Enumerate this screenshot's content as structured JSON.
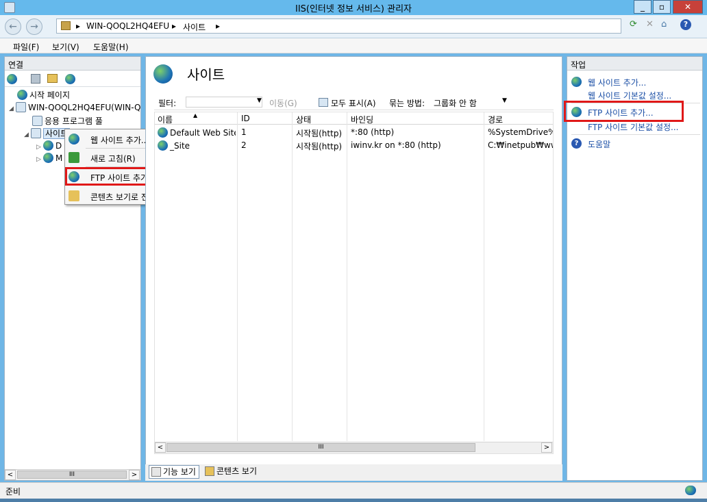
{
  "window": {
    "title": "IIS(인터넷 정보 서비스) 관리자",
    "min": "_",
    "max": "▫",
    "close": "✕"
  },
  "nav": {
    "back": "←",
    "forward": "→",
    "crumbs": [
      "▸",
      "WIN-QOQL2HQ4EFU",
      "▸",
      "사이트",
      "▸"
    ],
    "tools": [
      "⟳",
      "✕",
      "⌂",
      "?"
    ]
  },
  "menu": [
    "파일(F)",
    "보기(V)",
    "도움말(H)"
  ],
  "connections": {
    "header": "연결",
    "tree": [
      {
        "label": "시작 페이지",
        "expander": ""
      },
      {
        "label": "WIN-QOQL2HQ4EFU(WIN-Q",
        "expander": "◢"
      },
      {
        "label": "응용 프로그램 풀",
        "expander": ""
      },
      {
        "label": "사이트",
        "expander": "◢"
      },
      {
        "label": "D",
        "expander": "▷"
      },
      {
        "label": "M",
        "expander": "▷"
      }
    ],
    "scroll_mid": "III",
    "scroll_left": "<",
    "scroll_right": ">"
  },
  "context_menu": {
    "items": [
      "웹 사이트 추가...",
      "새로 고침(R)",
      "FTP 사이트 추가...",
      "콘텐츠 보기로 전환"
    ],
    "highlighted": "FTP 사이트 추가...",
    "highlight_color": "#e01818"
  },
  "center": {
    "title": "사이트",
    "filter_label": "필터:",
    "go_label": "이동(G)",
    "show_all_label": "모두 표시(A)",
    "group_label": "묶는 방법:",
    "group_value": "그룹화 안 함",
    "columns": [
      "이름",
      "ID",
      "상태",
      "바인딩",
      "경로"
    ],
    "sort_arrow": "▲",
    "rows": [
      {
        "name": "Default Web Site",
        "id": "1",
        "status": "시작됨(http)",
        "binding": "*:80 (http)",
        "path": "%SystemDrive%₩"
      },
      {
        "name": "_Site",
        "id": "2",
        "status": "시작됨(http)",
        "binding": "iwinv.kr on *:80 (http)",
        "path": "C:₩inetpub₩www"
      }
    ],
    "scroll_mid": "III",
    "scroll_left": "<",
    "scroll_right": ">",
    "tabs": [
      "기능 보기",
      "콘텐츠 보기"
    ]
  },
  "actions": {
    "header": "작업",
    "items": [
      "웹 사이트 추가...",
      "웹 사이트 기본값 설정...",
      "FTP 사이트 추가...",
      "FTP 사이트 기본값 설정...",
      "도움말"
    ],
    "help_glyph": "?"
  },
  "status": {
    "text": "준비"
  },
  "colors": {
    "link": "#1a4ea5",
    "titlebar": "#65b9ec",
    "highlight": "#e01818"
  }
}
